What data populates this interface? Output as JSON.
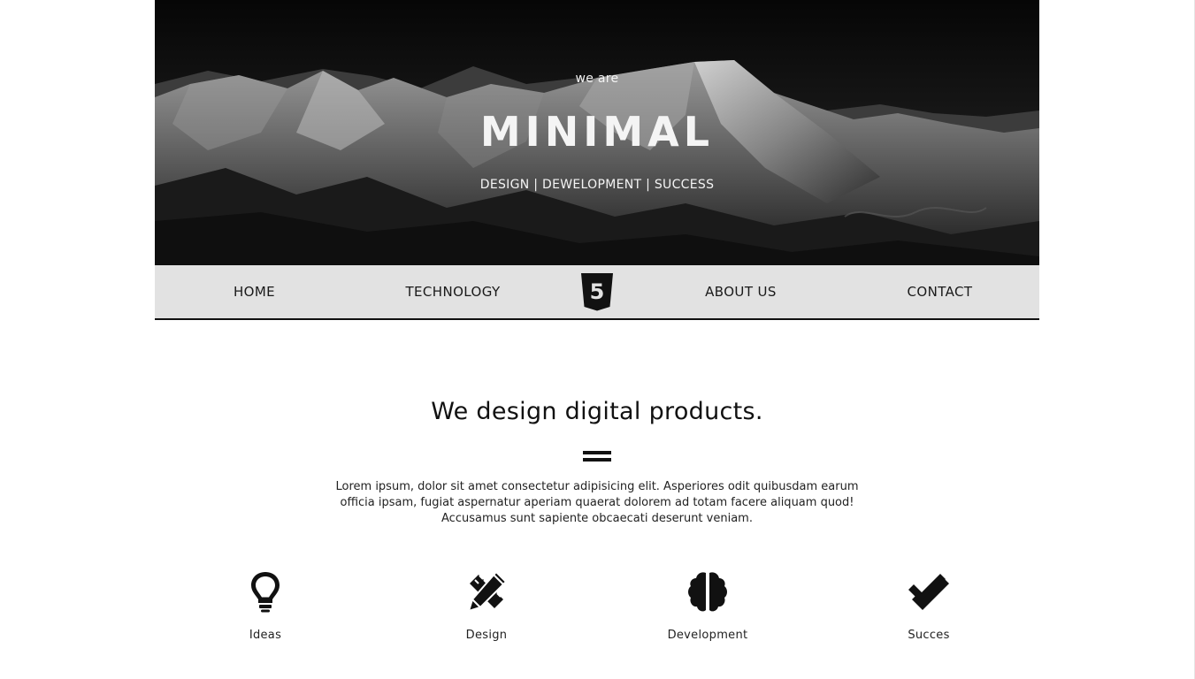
{
  "hero": {
    "kicker": "we are",
    "title": "MINIMAL",
    "tagline": "DESIGN | DEWELOPMENT | SUCCESS"
  },
  "nav": {
    "items": [
      {
        "label": "HOME"
      },
      {
        "label": "TECHNOLOGY"
      },
      {
        "label": "ABOUT US"
      },
      {
        "label": "CONTACT"
      }
    ],
    "logo_icon": "html5-shield-icon",
    "logo_text": "5"
  },
  "main": {
    "title": "We design digital products.",
    "divider_icon": "equals-icon",
    "intro": "Lorem ipsum, dolor sit amet consectetur adipisicing elit. Asperiores odit quibusdam earum officia ipsam, fugiat aspernatur aperiam quaerat dolorem ad totam facere aliquam quod! Accusamus sunt sapiente obcaecati deserunt veniam.",
    "features": [
      {
        "icon": "lightbulb-icon",
        "label": "Ideas"
      },
      {
        "icon": "pencil-ruler-icon",
        "label": "Design"
      },
      {
        "icon": "brain-icon",
        "label": "Development"
      },
      {
        "icon": "double-check-icon",
        "label": "Succes"
      }
    ]
  },
  "colors": {
    "nav_background": "#e2e2e2",
    "text_dark": "#111111",
    "hero_text": "#f4f4f4"
  }
}
